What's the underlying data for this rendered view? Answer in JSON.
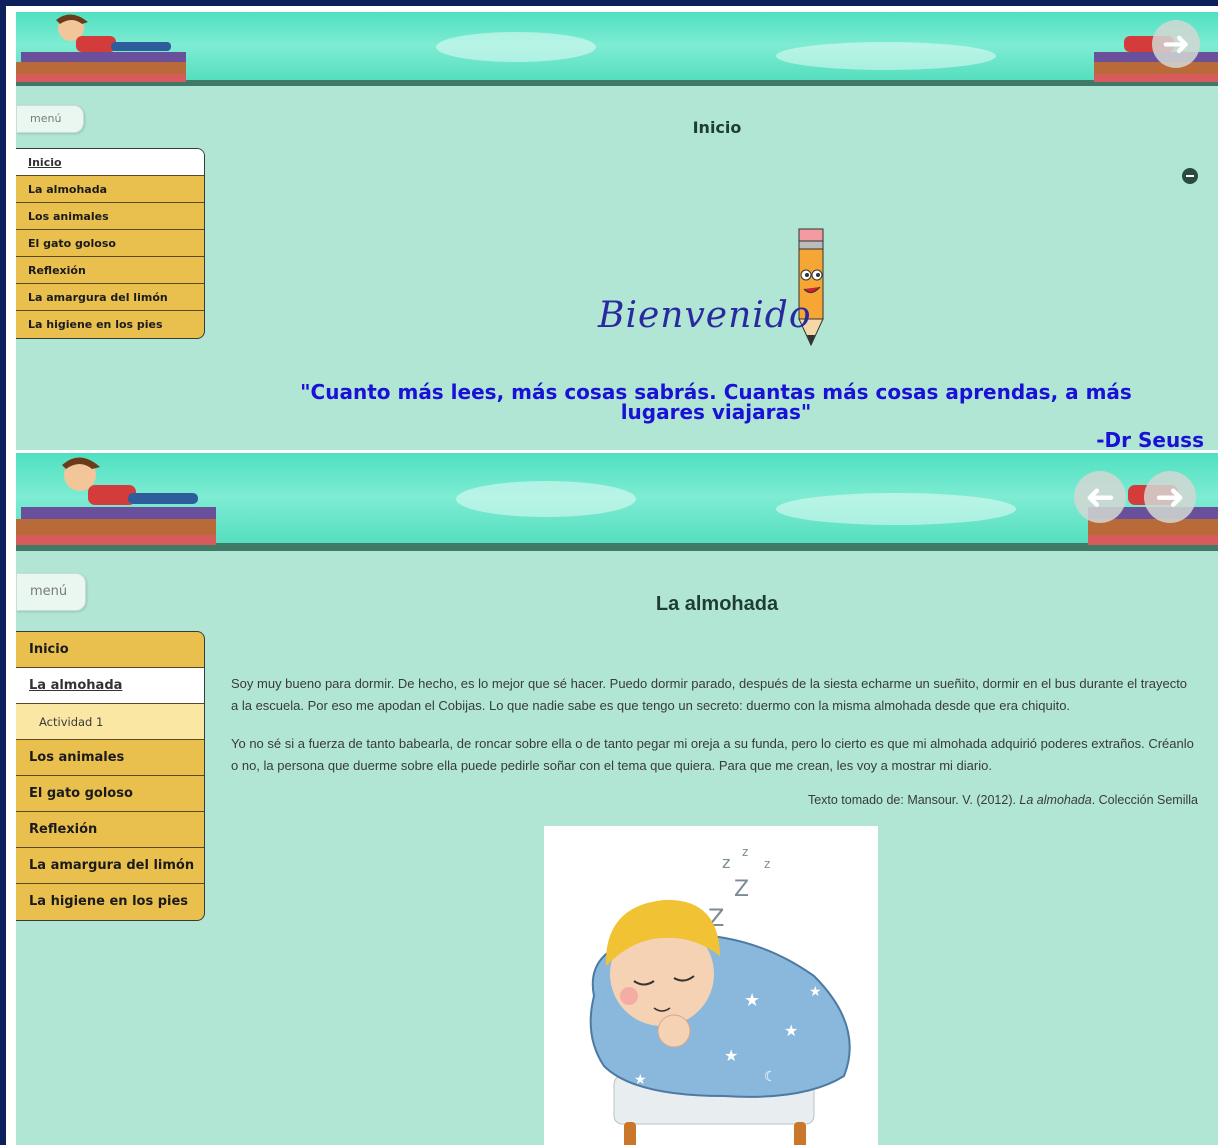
{
  "screen1": {
    "menu_label": "menú",
    "nav": [
      {
        "label": "Inicio",
        "active": true
      },
      {
        "label": "La almohada"
      },
      {
        "label": "Los animales"
      },
      {
        "label": "El gato goloso"
      },
      {
        "label": "Reflexión"
      },
      {
        "label": "La amargura del limón"
      },
      {
        "label": "La higiene en los pies"
      }
    ],
    "title": "Inicio",
    "welcome": "Bienvenido",
    "quote": "\"Cuanto más lees, más cosas sabrás. Cuantas más cosas aprendas, a más lugares viajaras\"",
    "author": "-Dr Seuss"
  },
  "screen2": {
    "menu_label": "menú",
    "nav": [
      {
        "label": "Inicio"
      },
      {
        "label": "La almohada",
        "active": true
      },
      {
        "label": "Actividad 1",
        "sub": true
      },
      {
        "label": "Los animales"
      },
      {
        "label": "El gato goloso"
      },
      {
        "label": "Reflexión"
      },
      {
        "label": "La amargura del limón"
      },
      {
        "label": "La higiene en los pies"
      }
    ],
    "title": "La almohada",
    "paragraph1": "Soy muy bueno para dormir. De hecho, es lo mejor que sé hacer. Puedo dormir parado, después de la siesta echarme un sueñito, dormir en el bus durante el trayecto a la escuela. Por eso me apodan el Cobijas. Lo que nadie sabe es que tengo un secreto: duermo con la misma almohada desde que era chiquito.",
    "paragraph2": "Yo no sé si a fuerza de tanto babearla, de roncar sobre ella o de tanto pegar mi oreja a su funda, pero lo cierto es que mi almohada adquirió poderes extraños. Créanlo o no, la persona que duerme sobre ella puede pedirle soñar con el tema que quiera. Para que me crean, les voy a mostrar mi diario.",
    "citation_prefix": "Texto tomado de: Mansour. V. (2012). ",
    "citation_title": "La almohada",
    "citation_suffix": ". Colección Semilla",
    "sleep_z": [
      "z",
      "z",
      "Z",
      "Z",
      "z"
    ]
  },
  "colors": {
    "background": "#b1e6d4",
    "nav_item": "#e9c04e",
    "quote": "#1a10d6",
    "border": "#0d1f5c"
  }
}
